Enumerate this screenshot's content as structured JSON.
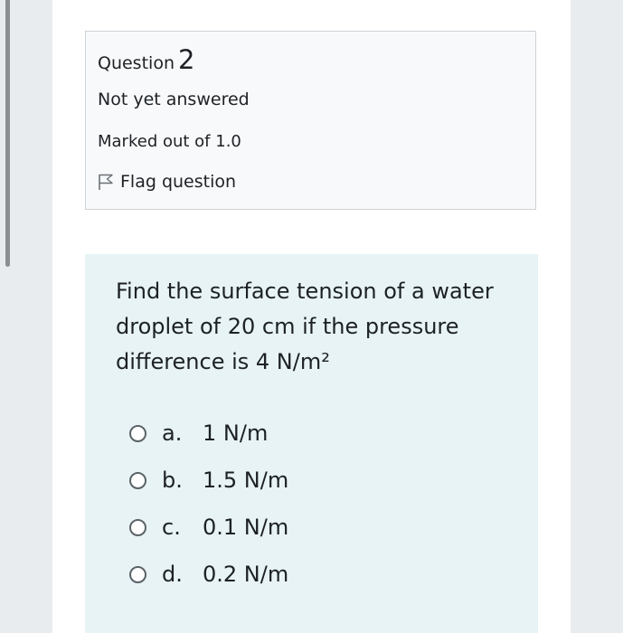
{
  "question_info": {
    "label": "Question",
    "number": "2",
    "state": "Not yet answered",
    "grade": "Marked out of 1.0",
    "flag_label": "Flag question",
    "flag_icon": "flag-outline-icon"
  },
  "question": {
    "text": "Find the surface tension of a water droplet of 20 cm if the pressure difference is 4 N/m²",
    "answers": [
      {
        "letter": "a.",
        "text": "1 N/m"
      },
      {
        "letter": "b.",
        "text": "1.5 N/m"
      },
      {
        "letter": "c.",
        "text": "0.1 N/m"
      },
      {
        "letter": "d.",
        "text": "0.2 N/m"
      }
    ]
  },
  "colors": {
    "info_background": "#f8f9fa",
    "content_background": "#e7f3f5",
    "page_background": "#e9ecef"
  }
}
